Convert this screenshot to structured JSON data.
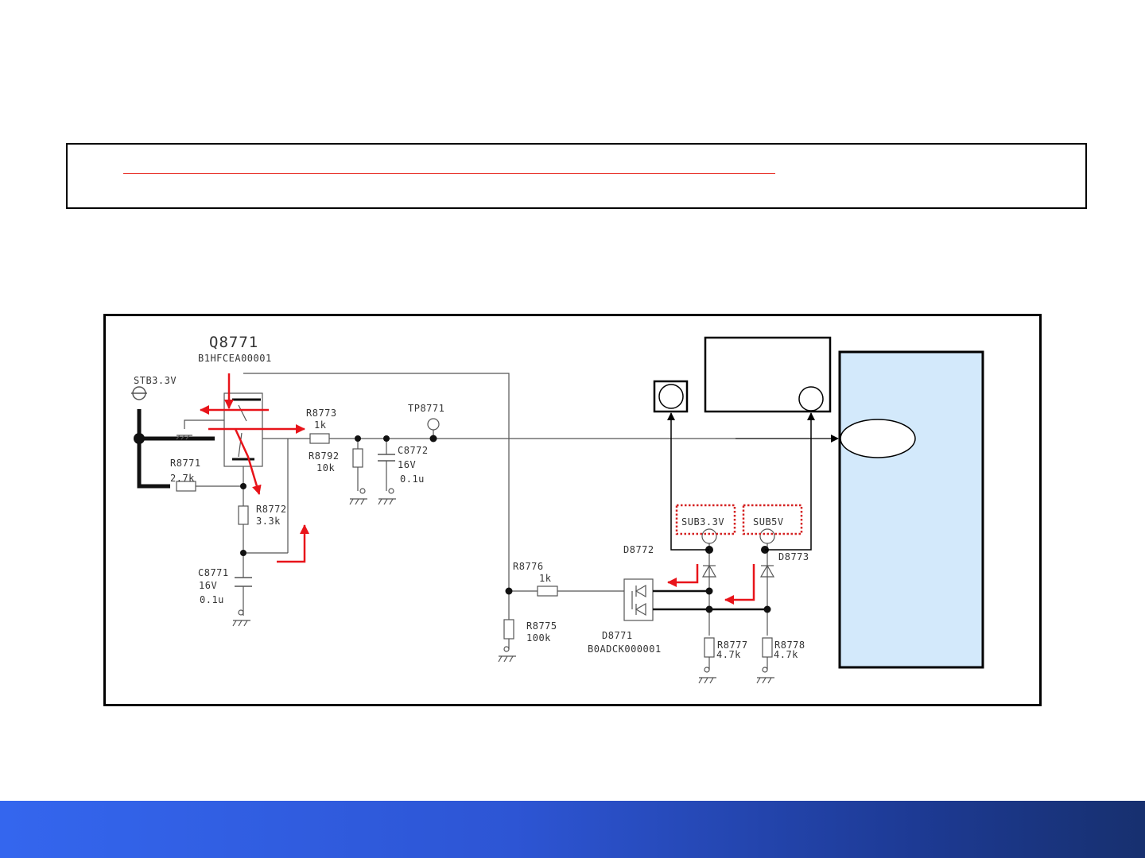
{
  "labels": {
    "q8771": "Q8771",
    "q8771_part": "B1HFCEA00001",
    "stb": "STB3.3V",
    "r8771": "R8771",
    "r8771_val": "2.7k",
    "r8772": "R8772",
    "r8772_val": "3.3k",
    "c8771": "C8771",
    "c8771_v": "16V",
    "c8771_val": "0.1u",
    "r8773": "R8773",
    "r8773_val": "1k",
    "r8792": "R8792",
    "r8792_val": "10k",
    "tp8771": "TP8771",
    "c8772": "C8772",
    "c8772_v": "16V",
    "c8772_val": "0.1u",
    "r8776": "R8776",
    "r8776_val": "1k",
    "r8775": "R8775",
    "r8775_val": "100k",
    "d8771": "D8771",
    "d8771_part": "B0ADCK000001",
    "d8772": "D8772",
    "d8773": "D8773",
    "sub33": "SUB3.3V",
    "sub5": "SUB5V",
    "r8777": "R8777",
    "r8777_val": "4.7k",
    "r8778": "R8778",
    "r8778_val": "4.7k"
  },
  "colors": {
    "flow_arrow": "#e8141a",
    "highlight_box": "#d42020",
    "ic_block": "#d3e9fb",
    "footer_start": "#3466ee",
    "footer_end": "#17306f"
  }
}
